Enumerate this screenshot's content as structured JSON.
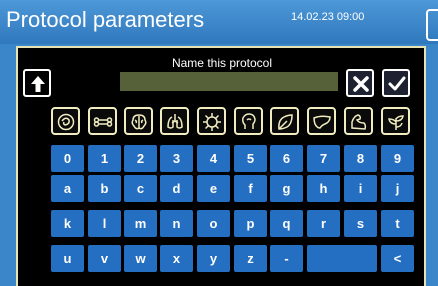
{
  "header": {
    "title": "Protocol parameters",
    "datetime": "14.02.23 09:00"
  },
  "dialog": {
    "title": "Name this protocol",
    "name_value": ""
  },
  "categories": [
    "stomach-icon",
    "bone-icon",
    "brain-icon",
    "lungs-icon",
    "virus-icon",
    "head-icon",
    "leaf-icon",
    "liver-icon",
    "arm-muscle-icon",
    "plant-icon"
  ],
  "keyboard": {
    "row1": [
      "0",
      "1",
      "2",
      "3",
      "4",
      "5",
      "6",
      "7",
      "8",
      "9"
    ],
    "row2": [
      "a",
      "b",
      "c",
      "d",
      "e",
      "f",
      "g",
      "h",
      "i",
      "j"
    ],
    "row3": [
      "k",
      "l",
      "m",
      "n",
      "o",
      "p",
      "q",
      "r",
      "s",
      "t"
    ],
    "row4": [
      "u",
      "v",
      "w",
      "x",
      "y",
      "z",
      "-",
      "",
      "<"
    ]
  },
  "colors": {
    "background": "#3a86c8",
    "panel": "#000000",
    "key": "#246fc2",
    "input": "#56613a",
    "border": "#e6e3b4"
  }
}
